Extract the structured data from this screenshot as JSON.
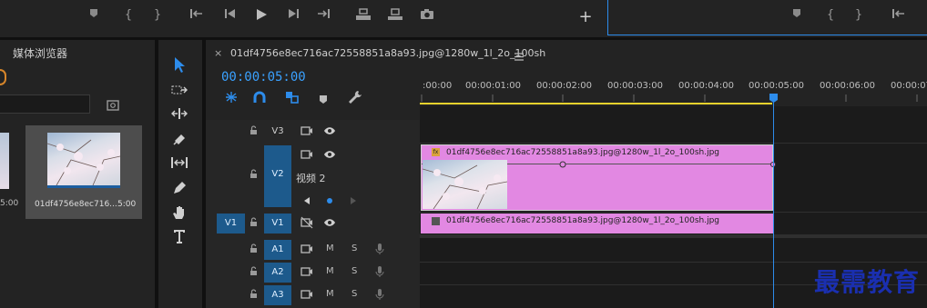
{
  "panels": {
    "media_browser": {
      "title": "媒体浏览器",
      "thumb_name": "01df4756e8ec716...",
      "thumb_duration": "5:00",
      "left_duration": "5:00"
    },
    "timeline": {
      "tab_title": "01df4756e8ec716ac72558851a8a93.jpg@1280w_1l_2o_100sh",
      "timecode": "00:00:05:00",
      "ruler": [
        ":00:00",
        "00:00:01:00",
        "00:00:02:00",
        "00:00:03:00",
        "00:00:04:00",
        "00:00:05:00",
        "00:00:06:00",
        "00:00:07"
      ]
    }
  },
  "tracks": {
    "video": [
      {
        "name": "V3"
      },
      {
        "name": "V2",
        "label": "视频 2"
      },
      {
        "name": "V1",
        "source": "V1"
      }
    ],
    "audio": [
      {
        "name": "A1",
        "m": "M",
        "s": "S"
      },
      {
        "name": "A2",
        "m": "M",
        "s": "S"
      },
      {
        "name": "A3",
        "m": "M",
        "s": "S"
      }
    ]
  },
  "clips": {
    "v2_name": "01df4756e8ec716ac72558851a8a93.jpg@1280w_1l_2o_100sh.jpg",
    "v1_name": "01df4756e8ec716ac72558851a8a93.jpg@1280w_1l_2o_100sh.jpg",
    "fx_badge": "fx"
  },
  "watermark": "最需教育",
  "colors": {
    "accent": "#2d8ceb",
    "clip": "#e288e2",
    "track_blue": "#1d5a8c",
    "work_area": "#e7d22d"
  }
}
